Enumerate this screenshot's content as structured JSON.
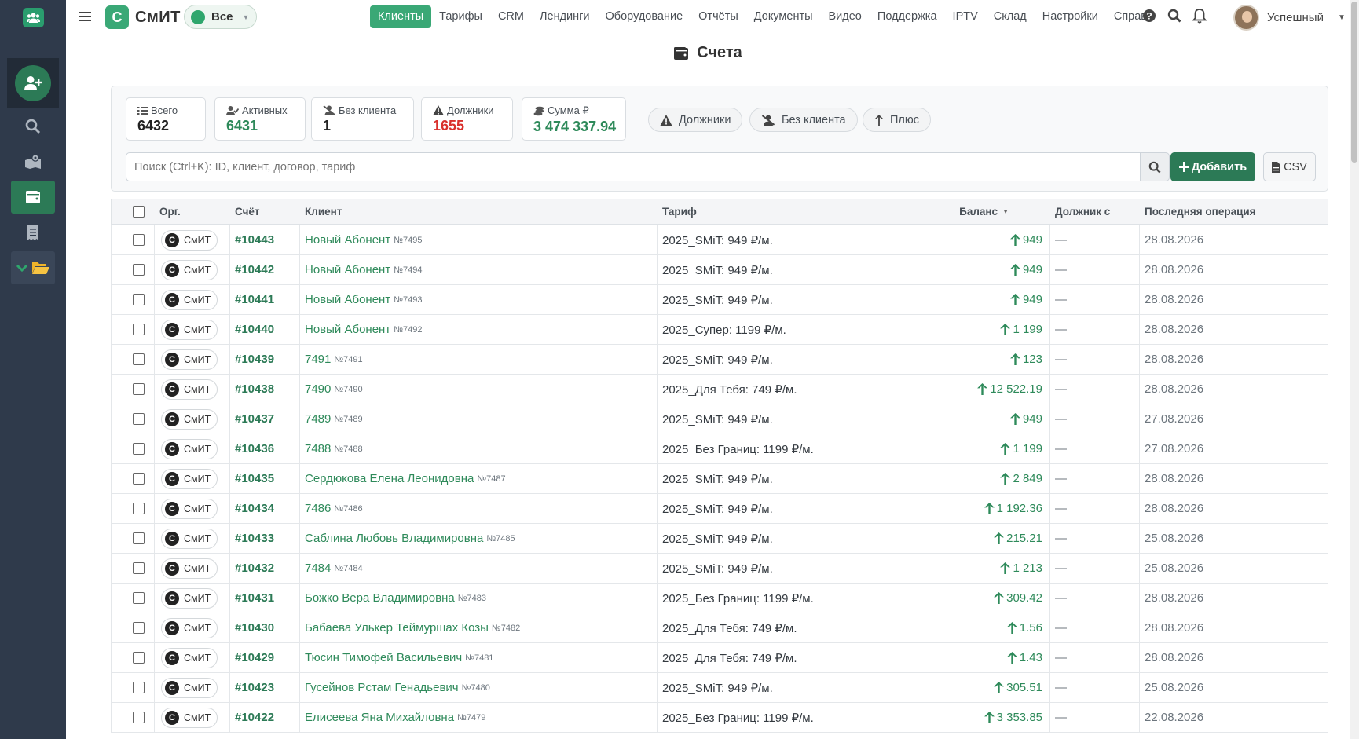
{
  "app": {
    "brand_letter": "С",
    "brand_name": "СмИТ",
    "scope": "Все"
  },
  "nav": [
    "Клиенты",
    "Тарифы",
    "CRM",
    "Лендинги",
    "Оборудование",
    "Отчёты",
    "Документы",
    "Видео",
    "Поддержка",
    "IPTV",
    "Склад",
    "Настройки",
    "Справ."
  ],
  "user": {
    "name": "Успешный"
  },
  "page": {
    "title": "Счета"
  },
  "stats": {
    "total": {
      "label": "Всего",
      "value": "6432"
    },
    "active": {
      "label": "Активных",
      "value": "6431"
    },
    "no_client": {
      "label": "Без клиента",
      "value": "1"
    },
    "debtors": {
      "label": "Должники",
      "value": "1655"
    },
    "sum": {
      "label": "Сумма ₽",
      "value": "3 474 337.94"
    }
  },
  "filters": {
    "debtors": "Должники",
    "no_client": "Без клиента",
    "plus": "Плюс"
  },
  "search": {
    "placeholder": "Поиск (Ctrl+K): ID, клиент, договор, тариф"
  },
  "buttons": {
    "add": "Добавить",
    "csv": "CSV"
  },
  "colors": {
    "accent": "#2c7a56",
    "danger": "#d9302c",
    "sidebar": "#2f3a4b"
  },
  "table": {
    "headers": {
      "org": "Орг.",
      "account": "Счёт",
      "client": "Клиент",
      "tariff": "Тариф",
      "balance": "Баланс",
      "debtor_since": "Должник с",
      "last_op": "Последняя операция"
    },
    "rows": [
      {
        "org": "СмИТ",
        "account": "#10443",
        "client": "Новый Абонент",
        "client_no": "№7495",
        "tariff": "2025_SMiT: 949 ₽/м.",
        "balance": "949",
        "debtor": "—",
        "last_op": "28.08.2026"
      },
      {
        "org": "СмИТ",
        "account": "#10442",
        "client": "Новый Абонент",
        "client_no": "№7494",
        "tariff": "2025_SMiT: 949 ₽/м.",
        "balance": "949",
        "debtor": "—",
        "last_op": "28.08.2026"
      },
      {
        "org": "СмИТ",
        "account": "#10441",
        "client": "Новый Абонент",
        "client_no": "№7493",
        "tariff": "2025_SMiT: 949 ₽/м.",
        "balance": "949",
        "debtor": "—",
        "last_op": "28.08.2026"
      },
      {
        "org": "СмИТ",
        "account": "#10440",
        "client": "Новый Абонент",
        "client_no": "№7492",
        "tariff": "2025_Супер: 1199 ₽/м.",
        "balance": "1 199",
        "debtor": "—",
        "last_op": "28.08.2026"
      },
      {
        "org": "СмИТ",
        "account": "#10439",
        "client": "7491",
        "client_no": "№7491",
        "tariff": "2025_SMiT: 949 ₽/м.",
        "balance": "123",
        "debtor": "—",
        "last_op": "28.08.2026"
      },
      {
        "org": "СмИТ",
        "account": "#10438",
        "client": "7490",
        "client_no": "№7490",
        "tariff": "2025_Для Тебя: 749 ₽/м.",
        "balance": "12 522.19",
        "debtor": "—",
        "last_op": "28.08.2026"
      },
      {
        "org": "СмИТ",
        "account": "#10437",
        "client": "7489",
        "client_no": "№7489",
        "tariff": "2025_SMiT: 949 ₽/м.",
        "balance": "949",
        "debtor": "—",
        "last_op": "27.08.2026"
      },
      {
        "org": "СмИТ",
        "account": "#10436",
        "client": "7488",
        "client_no": "№7488",
        "tariff": "2025_Без Границ: 1199 ₽/м.",
        "balance": "1 199",
        "debtor": "—",
        "last_op": "27.08.2026"
      },
      {
        "org": "СмИТ",
        "account": "#10435",
        "client": "Сердюкова Елена Леонидовна",
        "client_no": "№7487",
        "tariff": "2025_SMiT: 949 ₽/м.",
        "balance": "2 849",
        "debtor": "—",
        "last_op": "28.08.2026"
      },
      {
        "org": "СмИТ",
        "account": "#10434",
        "client": "7486",
        "client_no": "№7486",
        "tariff": "2025_SMiT: 949 ₽/м.",
        "balance": "1 192.36",
        "debtor": "—",
        "last_op": "28.08.2026"
      },
      {
        "org": "СмИТ",
        "account": "#10433",
        "client": "Саблина Любовь Владимировна",
        "client_no": "№7485",
        "tariff": "2025_SMiT: 949 ₽/м.",
        "balance": "215.21",
        "debtor": "—",
        "last_op": "25.08.2026"
      },
      {
        "org": "СмИТ",
        "account": "#10432",
        "client": "7484",
        "client_no": "№7484",
        "tariff": "2025_SMiT: 949 ₽/м.",
        "balance": "1 213",
        "debtor": "—",
        "last_op": "25.08.2026"
      },
      {
        "org": "СмИТ",
        "account": "#10431",
        "client": "Божко Вера Владимировна",
        "client_no": "№7483",
        "tariff": "2025_Без Границ: 1199 ₽/м.",
        "balance": "309.42",
        "debtor": "—",
        "last_op": "28.08.2026"
      },
      {
        "org": "СмИТ",
        "account": "#10430",
        "client": "Бабаева Улькер Теймуршах Козы",
        "client_no": "№7482",
        "tariff": "2025_Для Тебя: 749 ₽/м.",
        "balance": "1.56",
        "debtor": "—",
        "last_op": "28.08.2026"
      },
      {
        "org": "СмИТ",
        "account": "#10429",
        "client": "Тюсин Тимофей Васильевич",
        "client_no": "№7481",
        "tariff": "2025_Для Тебя: 749 ₽/м.",
        "balance": "1.43",
        "debtor": "—",
        "last_op": "28.08.2026"
      },
      {
        "org": "СмИТ",
        "account": "#10423",
        "client": "Гусейнов Рстам Генадьевич",
        "client_no": "№7480",
        "tariff": "2025_SMiT: 949 ₽/м.",
        "balance": "305.51",
        "debtor": "—",
        "last_op": "25.08.2026"
      },
      {
        "org": "СмИТ",
        "account": "#10422",
        "client": "Елисеева Яна Михайловна",
        "client_no": "№7479",
        "tariff": "2025_Без Границ: 1199 ₽/м.",
        "balance": "3 353.85",
        "debtor": "—",
        "last_op": "22.08.2026"
      }
    ]
  }
}
